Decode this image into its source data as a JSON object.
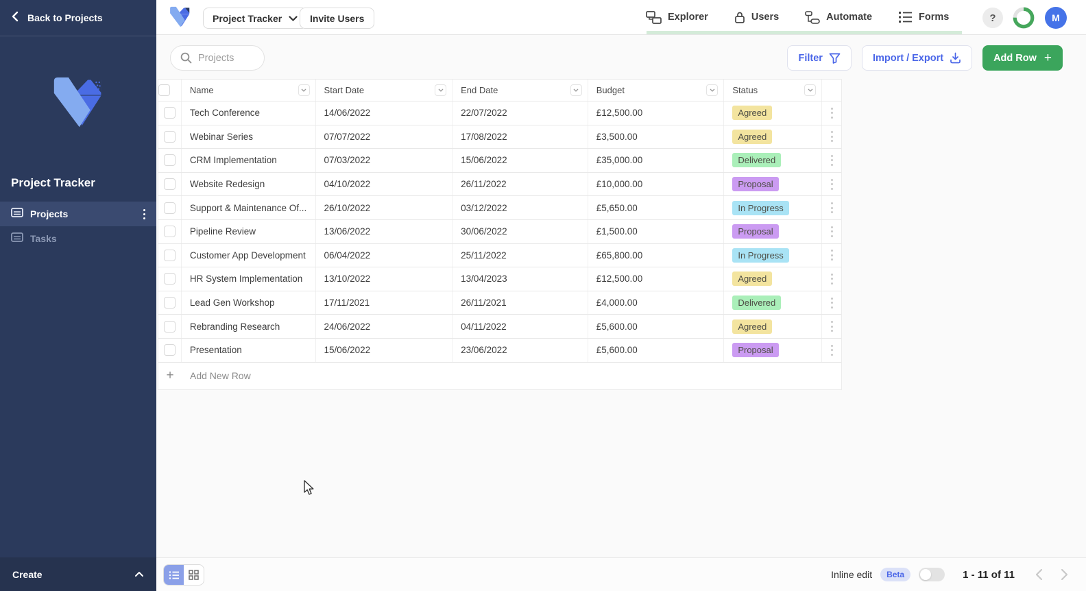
{
  "sidebar": {
    "back_label": "Back to Projects",
    "workspace_title": "Project Tracker",
    "items": [
      {
        "label": "Projects",
        "active": true
      },
      {
        "label": "Tasks",
        "active": false
      }
    ],
    "create_label": "Create"
  },
  "header": {
    "app_button_label": "Project Tracker",
    "invite_button_label": "Invite Users",
    "nav": [
      {
        "label": "Explorer",
        "icon": "explorer-icon"
      },
      {
        "label": "Users",
        "icon": "lock-icon"
      },
      {
        "label": "Automate",
        "icon": "automate-icon"
      },
      {
        "label": "Forms",
        "icon": "forms-icon"
      }
    ],
    "help_label": "?",
    "avatar_initial": "M"
  },
  "toolbar": {
    "search_placeholder": "Projects",
    "filter_label": "Filter",
    "import_export_label": "Import / Export",
    "add_row_label": "Add Row",
    "add_row_plus": "+"
  },
  "table": {
    "columns": [
      "Name",
      "Start Date",
      "End Date",
      "Budget",
      "Status"
    ],
    "rows": [
      {
        "name": "Tech Conference",
        "start_date": "14/06/2022",
        "end_date": "22/07/2022",
        "budget": "£12,500.00",
        "status": "Agreed"
      },
      {
        "name": "Webinar Series",
        "start_date": "07/07/2022",
        "end_date": "17/08/2022",
        "budget": "£3,500.00",
        "status": "Agreed"
      },
      {
        "name": "CRM Implementation",
        "start_date": "07/03/2022",
        "end_date": "15/06/2022",
        "budget": "£35,000.00",
        "status": "Delivered"
      },
      {
        "name": "Website Redesign",
        "start_date": "04/10/2022",
        "end_date": "26/11/2022",
        "budget": "£10,000.00",
        "status": "Proposal"
      },
      {
        "name": "Support & Maintenance Of...",
        "start_date": "26/10/2022",
        "end_date": "03/12/2022",
        "budget": "£5,650.00",
        "status": "In Progress"
      },
      {
        "name": "Pipeline Review",
        "start_date": "13/06/2022",
        "end_date": "30/06/2022",
        "budget": "£1,500.00",
        "status": "Proposal"
      },
      {
        "name": "Customer App Development",
        "start_date": "06/04/2022",
        "end_date": "25/11/2022",
        "budget": "£65,800.00",
        "status": "In Progress"
      },
      {
        "name": "HR System Implementation",
        "start_date": "13/10/2022",
        "end_date": "13/04/2023",
        "budget": "£12,500.00",
        "status": "Agreed"
      },
      {
        "name": "Lead Gen Workshop",
        "start_date": "17/11/2021",
        "end_date": "26/11/2021",
        "budget": "£4,000.00",
        "status": "Delivered"
      },
      {
        "name": "Rebranding Research",
        "start_date": "24/06/2022",
        "end_date": "04/11/2022",
        "budget": "£5,600.00",
        "status": "Agreed"
      },
      {
        "name": "Presentation",
        "start_date": "15/06/2022",
        "end_date": "23/06/2022",
        "budget": "£5,600.00",
        "status": "Proposal"
      }
    ],
    "add_new_row_label": "Add New Row",
    "add_new_row_plus": "+"
  },
  "footer": {
    "inline_edit_label": "Inline edit",
    "beta_label": "Beta",
    "range_label": "1 - 11 of 11"
  },
  "colors": {
    "accent_blue": "#4A66E8",
    "green": "#3BA55C",
    "sidebar_navy": "#2B3A5C",
    "status": {
      "Agreed": "#F3E49F",
      "Delivered": "#AAEFB9",
      "Proposal": "#CB9BF2",
      "In Progress": "#A9E3F5"
    }
  }
}
